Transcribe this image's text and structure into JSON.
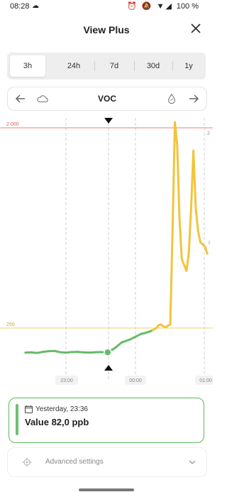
{
  "status_bar": {
    "time": "08:28",
    "battery": "100 %"
  },
  "header": {
    "title": "View Plus",
    "close_icon": "close-icon"
  },
  "range_selector": {
    "options": [
      "3h",
      "24h",
      "7d",
      "30d",
      "1y"
    ],
    "selected": "3h"
  },
  "sensor_nav": {
    "label": "VOC",
    "left_icon": "cloud-icon",
    "right_icon": "water-drop-icon"
  },
  "chart": {
    "threshold_high": {
      "label": "2 000",
      "right_label": "2",
      "color": "#e05555"
    },
    "threshold_low": {
      "label": "250",
      "color": "#e8c43a"
    },
    "right_mid_label": "1",
    "x_labels": [
      "23:00",
      "00:00",
      "01:00"
    ],
    "colors": {
      "good": "#66bb6a",
      "warn": "#f2c43d"
    }
  },
  "chart_data": {
    "type": "line",
    "title": "",
    "xlabel": "",
    "ylabel": "",
    "reference_lines": [
      2000,
      250
    ],
    "ylim": [
      0,
      2500
    ],
    "x_ticks": [
      "23:00",
      "00:00",
      "01:00"
    ],
    "selected_point": {
      "x": "23:36",
      "y": 82.0
    },
    "series": [
      {
        "x": [
          "22:25",
          "22:30",
          "22:35",
          "22:40",
          "22:45",
          "22:50",
          "22:55",
          "23:00",
          "23:05",
          "23:10",
          "23:15",
          "23:20",
          "23:25",
          "23:30",
          "23:36",
          "23:42",
          "23:48",
          "23:55",
          "00:00",
          "00:05",
          "00:08",
          "00:12",
          "00:15",
          "00:18",
          "00:20",
          "00:22",
          "00:24",
          "00:26",
          "00:28",
          "00:30",
          "00:32",
          "00:34",
          "00:36",
          "00:38",
          "00:40",
          "00:42",
          "00:44",
          "00:46",
          "00:48",
          "00:50",
          "00:52",
          "00:54",
          "00:56",
          "00:58",
          "01:00",
          "01:02"
        ],
        "values": [
          80,
          82,
          78,
          85,
          90,
          92,
          83,
          80,
          84,
          85,
          82,
          80,
          83,
          84,
          82,
          110,
          150,
          170,
          190,
          210,
          215,
          225,
          235,
          250,
          275,
          280,
          265,
          255,
          270,
          280,
          1100,
          2050,
          1850,
          1200,
          850,
          800,
          750,
          900,
          1300,
          1800,
          1300,
          1100,
          1000,
          980,
          960,
          900
        ]
      }
    ]
  },
  "card": {
    "date": "Yesterday, 23:36",
    "value": "Value 82,0 ppb"
  },
  "advanced": {
    "label": "Advanced settings"
  }
}
